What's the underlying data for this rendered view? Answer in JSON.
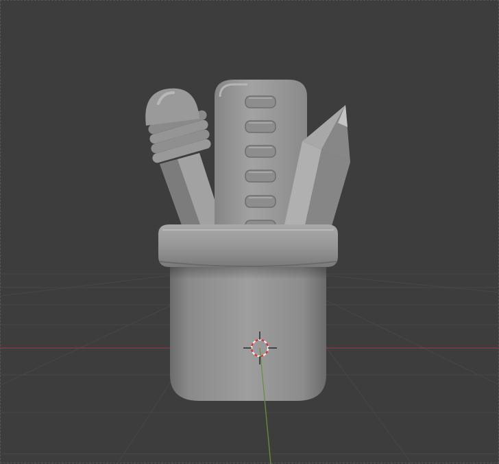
{
  "viewport": {
    "background": "#3d3d3d",
    "grid_color": "#474747",
    "x_axis_color": "#8a3b45",
    "y_axis_color": "#6b8f3a",
    "cursor_colors": [
      "#e03030",
      "#f0f0f0",
      "#202020"
    ]
  },
  "scene": {
    "object": "pen-holder-model",
    "material_color": "#9a9a9a",
    "contents": [
      "pencil-eraser",
      "ruler",
      "sharpened-pencil"
    ]
  },
  "cursor": {
    "icon": "3d-cursor-icon"
  }
}
